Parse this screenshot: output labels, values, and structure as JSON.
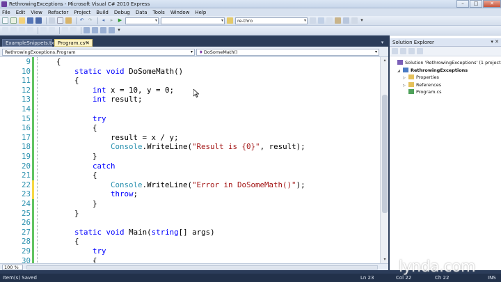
{
  "window": {
    "title": "RethrowingExceptions - Microsoft Visual C# 2010 Express",
    "controls": [
      "–",
      "□",
      "✕"
    ]
  },
  "menu": [
    "File",
    "Edit",
    "View",
    "Refactor",
    "Project",
    "Build",
    "Debug",
    "Data",
    "Tools",
    "Window",
    "Help"
  ],
  "toolbar": {
    "find_combo_value": "re-thro"
  },
  "tabs": {
    "items": [
      {
        "label": "ExampleSnippets.txt"
      },
      {
        "label": "Program.cs*",
        "close": "✕"
      }
    ],
    "dropdown": "▾"
  },
  "navbar": {
    "class_combo": "RethrowingExceptions.Program",
    "member_combo": "DoSomeMath()",
    "member_icon": "♦"
  },
  "code_lines": [
    {
      "n": "9",
      "segments": [
        {
          "t": "    {",
          "c": ""
        }
      ],
      "changed": false
    },
    {
      "n": "10",
      "segments": [
        {
          "t": "        ",
          "c": ""
        },
        {
          "t": "static",
          "c": "kw"
        },
        {
          "t": " ",
          "c": ""
        },
        {
          "t": "void",
          "c": "kw"
        },
        {
          "t": " DoSomeMath()",
          "c": ""
        }
      ],
      "changed": false
    },
    {
      "n": "11",
      "segments": [
        {
          "t": "        {",
          "c": ""
        }
      ],
      "changed": false
    },
    {
      "n": "12",
      "segments": [
        {
          "t": "            ",
          "c": ""
        },
        {
          "t": "int",
          "c": "kw"
        },
        {
          "t": " x = 10, y = 0;",
          "c": ""
        }
      ],
      "changed": false
    },
    {
      "n": "13",
      "segments": [
        {
          "t": "            ",
          "c": ""
        },
        {
          "t": "int",
          "c": "kw"
        },
        {
          "t": " result;",
          "c": ""
        }
      ],
      "changed": false
    },
    {
      "n": "14",
      "segments": [
        {
          "t": "",
          "c": ""
        }
      ],
      "changed": false
    },
    {
      "n": "15",
      "segments": [
        {
          "t": "            ",
          "c": ""
        },
        {
          "t": "try",
          "c": "kw"
        }
      ],
      "changed": false
    },
    {
      "n": "16",
      "segments": [
        {
          "t": "            {",
          "c": ""
        }
      ],
      "changed": false
    },
    {
      "n": "17",
      "segments": [
        {
          "t": "                result = x / y;",
          "c": ""
        }
      ],
      "changed": false
    },
    {
      "n": "18",
      "segments": [
        {
          "t": "                ",
          "c": ""
        },
        {
          "t": "Console",
          "c": "ty"
        },
        {
          "t": ".WriteLine(",
          "c": ""
        },
        {
          "t": "\"Result is {0}\"",
          "c": "str"
        },
        {
          "t": ", result);",
          "c": ""
        }
      ],
      "changed": false
    },
    {
      "n": "19",
      "segments": [
        {
          "t": "            }",
          "c": ""
        }
      ],
      "changed": false
    },
    {
      "n": "20",
      "segments": [
        {
          "t": "            ",
          "c": ""
        },
        {
          "t": "catch",
          "c": "kw"
        }
      ],
      "changed": false
    },
    {
      "n": "21",
      "segments": [
        {
          "t": "            {",
          "c": ""
        }
      ],
      "changed": false
    },
    {
      "n": "22",
      "segments": [
        {
          "t": "                ",
          "c": ""
        },
        {
          "t": "Console",
          "c": "ty"
        },
        {
          "t": ".WriteLine(",
          "c": ""
        },
        {
          "t": "\"Error in DoSomeMath()\"",
          "c": "str"
        },
        {
          "t": ");",
          "c": ""
        }
      ],
      "changed": true
    },
    {
      "n": "23",
      "segments": [
        {
          "t": "                ",
          "c": ""
        },
        {
          "t": "throw",
          "c": "kw"
        },
        {
          "t": ";",
          "c": ""
        }
      ],
      "changed": true
    },
    {
      "n": "24",
      "segments": [
        {
          "t": "            }",
          "c": ""
        }
      ],
      "changed": false
    },
    {
      "n": "25",
      "segments": [
        {
          "t": "        }",
          "c": ""
        }
      ],
      "changed": false
    },
    {
      "n": "26",
      "segments": [
        {
          "t": "",
          "c": ""
        }
      ],
      "changed": false
    },
    {
      "n": "27",
      "segments": [
        {
          "t": "        ",
          "c": ""
        },
        {
          "t": "static",
          "c": "kw"
        },
        {
          "t": " ",
          "c": ""
        },
        {
          "t": "void",
          "c": "kw"
        },
        {
          "t": " Main(",
          "c": ""
        },
        {
          "t": "string",
          "c": "kw"
        },
        {
          "t": "[] args)",
          "c": ""
        }
      ],
      "changed": false
    },
    {
      "n": "28",
      "segments": [
        {
          "t": "        {",
          "c": ""
        }
      ],
      "changed": false
    },
    {
      "n": "29",
      "segments": [
        {
          "t": "            ",
          "c": ""
        },
        {
          "t": "try",
          "c": "kw"
        }
      ],
      "changed": false
    },
    {
      "n": "30",
      "segments": [
        {
          "t": "            {",
          "c": ""
        }
      ],
      "changed": false
    }
  ],
  "editor": {
    "zoom": "100 %",
    "colors": {
      "keyword": "#0000ff",
      "string": "#a31515",
      "type": "#2b91af",
      "line_number": "#2b91af",
      "changed_marker": "#f6d743",
      "saved_marker": "#62c462"
    }
  },
  "solution_explorer": {
    "title": "Solution Explorer",
    "header_buttons": "▾ ✕",
    "tree": [
      {
        "label": "Solution 'RethrowingExceptions' (1 project)",
        "bold": false,
        "indent": 0,
        "expander": "",
        "icon": "solution-icon"
      },
      {
        "label": "RethrowingExceptions",
        "bold": true,
        "indent": 1,
        "expander": "◢",
        "icon": "project-icon"
      },
      {
        "label": "Properties",
        "bold": false,
        "indent": 2,
        "expander": "▷",
        "icon": "folder-icon"
      },
      {
        "label": "References",
        "bold": false,
        "indent": 2,
        "expander": "▷",
        "icon": "folder-icon"
      },
      {
        "label": "Program.cs",
        "bold": false,
        "indent": 2,
        "expander": "",
        "icon": "file-icon"
      }
    ]
  },
  "status": {
    "message": "Item(s) Saved",
    "line": "Ln 23",
    "col": "Col 22",
    "ch": "Ch 22",
    "mode": "INS"
  },
  "watermark": {
    "text": "lynda.com"
  }
}
